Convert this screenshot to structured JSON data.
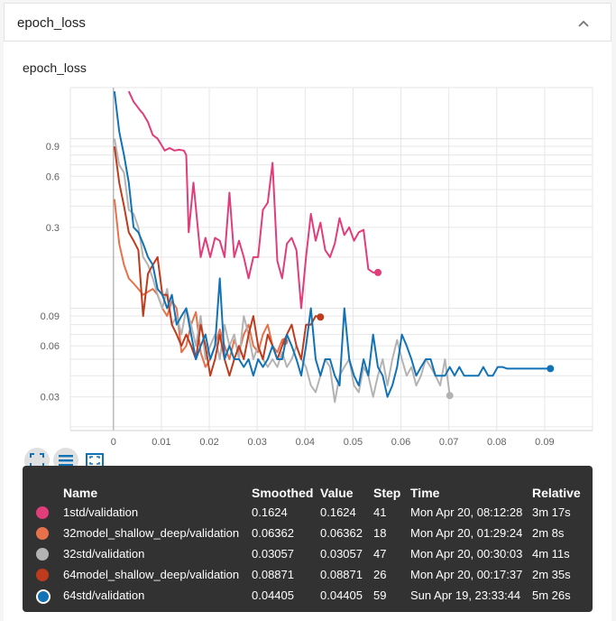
{
  "card": {
    "title": "epoch_loss"
  },
  "chart_data": {
    "type": "line",
    "title": "epoch_loss",
    "x_scale": "linear",
    "y_scale": "log",
    "xlim": [
      -0.009,
      0.1
    ],
    "ylim": [
      0.019,
      2.0
    ],
    "x_ticks": [
      "0",
      "0.01",
      "0.02",
      "0.03",
      "0.04",
      "0.05",
      "0.06",
      "0.07",
      "0.08",
      "0.09"
    ],
    "x_tick_values": [
      0,
      0.01,
      0.02,
      0.03,
      0.04,
      0.05,
      0.06,
      0.07,
      0.08,
      0.09
    ],
    "y_ticks": [
      "0.03",
      "0.06",
      "0.09",
      "0.3",
      "0.6",
      "0.9"
    ],
    "y_tick_values": [
      0.03,
      0.06,
      0.09,
      0.3,
      0.6,
      0.9
    ],
    "grid": true,
    "series": [
      {
        "name": "1std/validation",
        "color": "#e13d7a",
        "x": [
          0.0032,
          0.0042,
          0.0057,
          0.0062,
          0.0072,
          0.0082,
          0.0092,
          0.0097,
          0.0107,
          0.0117,
          0.0127,
          0.0137,
          0.0147,
          0.0152,
          0.0157,
          0.0167,
          0.0177,
          0.0182,
          0.0192,
          0.0202,
          0.0212,
          0.0222,
          0.0232,
          0.0242,
          0.0252,
          0.0262,
          0.0272,
          0.0282,
          0.0292,
          0.0302,
          0.0312,
          0.0322,
          0.0332,
          0.0342,
          0.0352,
          0.0362,
          0.0372,
          0.0382,
          0.0392,
          0.0402,
          0.0412,
          0.0422,
          0.0432,
          0.0442,
          0.0452,
          0.0462,
          0.0472,
          0.0482,
          0.0492,
          0.0502,
          0.0512,
          0.0522,
          0.0532,
          0.0542,
          0.0552
        ],
        "y": [
          1.9,
          1.65,
          1.45,
          1.4,
          1.25,
          1.05,
          1.0,
          0.95,
          0.85,
          0.88,
          0.85,
          0.86,
          0.85,
          0.8,
          0.28,
          0.55,
          0.28,
          0.2,
          0.26,
          0.2,
          0.26,
          0.25,
          0.2,
          0.48,
          0.2,
          0.25,
          0.2,
          0.15,
          0.2,
          0.2,
          0.38,
          0.42,
          0.72,
          0.19,
          0.15,
          0.24,
          0.26,
          0.22,
          0.1,
          0.2,
          0.36,
          0.25,
          0.32,
          0.22,
          0.2,
          0.24,
          0.34,
          0.27,
          0.3,
          0.25,
          0.28,
          0.29,
          0.17,
          0.1624,
          0.1624
        ]
      },
      {
        "name": "32model_shallow_deep/validation",
        "color": "#e7714a",
        "x": [
          0.0002,
          0.0012,
          0.0022,
          0.0032,
          0.0042,
          0.0052,
          0.0062,
          0.0072,
          0.0082,
          0.0092,
          0.0102,
          0.0112,
          0.0122,
          0.0132,
          0.0142,
          0.0152,
          0.0162,
          0.0172,
          0.0182,
          0.0192,
          0.0202,
          0.0212,
          0.0222,
          0.0232,
          0.0242,
          0.0252,
          0.0262,
          0.0272,
          0.0282,
          0.0292,
          0.0302,
          0.0312,
          0.0322,
          0.0332,
          0.0342,
          0.0352,
          0.0357
        ],
        "y": [
          0.44,
          0.24,
          0.18,
          0.15,
          0.14,
          0.13,
          0.12,
          0.125,
          0.13,
          0.12,
          0.1,
          0.09,
          0.11,
          0.1,
          0.055,
          0.06,
          0.08,
          0.095,
          0.055,
          0.045,
          0.05,
          0.06,
          0.075,
          0.06,
          0.05,
          0.065,
          0.055,
          0.07,
          0.08,
          0.06,
          0.055,
          0.07,
          0.08,
          0.06,
          0.055,
          0.065,
          0.06362
        ]
      },
      {
        "name": "32std/validation",
        "color": "#b3b3b3",
        "x": [
          0.0002,
          0.0012,
          0.0022,
          0.0032,
          0.0042,
          0.0052,
          0.0062,
          0.0072,
          0.0082,
          0.0092,
          0.0102,
          0.0112,
          0.0122,
          0.0132,
          0.0142,
          0.0152,
          0.0162,
          0.0172,
          0.0182,
          0.0192,
          0.0202,
          0.0212,
          0.0222,
          0.0232,
          0.0242,
          0.0252,
          0.0262,
          0.0272,
          0.0282,
          0.0292,
          0.0302,
          0.0312,
          0.0322,
          0.0332,
          0.0342,
          0.0352,
          0.0362,
          0.0372,
          0.0382,
          0.0392,
          0.0402,
          0.0412,
          0.0422,
          0.0432,
          0.0442,
          0.0452,
          0.0462,
          0.0472,
          0.0482,
          0.0492,
          0.0502,
          0.0512,
          0.0522,
          0.0532,
          0.0542,
          0.0552,
          0.0562,
          0.0572,
          0.0582,
          0.0592,
          0.0602,
          0.0612,
          0.0622,
          0.0632,
          0.0642,
          0.0652,
          0.0662,
          0.0672,
          0.0682,
          0.0692,
          0.0702
        ],
        "y": [
          1.0,
          0.7,
          0.63,
          0.38,
          0.36,
          0.3,
          0.2,
          0.18,
          0.15,
          0.12,
          0.1,
          0.13,
          0.08,
          0.09,
          0.07,
          0.1,
          0.08,
          0.06,
          0.09,
          0.05,
          0.06,
          0.07,
          0.05,
          0.08,
          0.06,
          0.07,
          0.05,
          0.09,
          0.07,
          0.05,
          0.06,
          0.05,
          0.045,
          0.05,
          0.045,
          0.055,
          0.045,
          0.05,
          0.06,
          0.05,
          0.045,
          0.035,
          0.032,
          0.04,
          0.05,
          0.045,
          0.028,
          0.04,
          0.045,
          0.05,
          0.035,
          0.032,
          0.045,
          0.04,
          0.03,
          0.04,
          0.05,
          0.035,
          0.05,
          0.065,
          0.05,
          0.04,
          0.045,
          0.035,
          0.04,
          0.05,
          0.045,
          0.04,
          0.035,
          0.05,
          0.03057
        ]
      },
      {
        "name": "64model_shallow_deep/validation",
        "color": "#bf3b1e",
        "x": [
          0.0002,
          0.0012,
          0.0022,
          0.0032,
          0.0042,
          0.0052,
          0.0062,
          0.0072,
          0.0082,
          0.0092,
          0.0102,
          0.0112,
          0.0122,
          0.0132,
          0.0142,
          0.0152,
          0.0162,
          0.0172,
          0.0182,
          0.0192,
          0.0202,
          0.0212,
          0.0222,
          0.0232,
          0.0242,
          0.0252,
          0.0262,
          0.0272,
          0.0282,
          0.0292,
          0.0302,
          0.0312,
          0.0322,
          0.0332,
          0.0342,
          0.0352,
          0.0362,
          0.0372,
          0.0382,
          0.0392,
          0.0402,
          0.0412,
          0.0422,
          0.0432
        ],
        "y": [
          0.9,
          0.55,
          0.4,
          0.28,
          0.25,
          0.22,
          0.09,
          0.16,
          0.18,
          0.2,
          0.12,
          0.12,
          0.08,
          0.07,
          0.06,
          0.07,
          0.06,
          0.05,
          0.08,
          0.06,
          0.04,
          0.05,
          0.07,
          0.05,
          0.04,
          0.05,
          0.06,
          0.05,
          0.07,
          0.09,
          0.06,
          0.05,
          0.07,
          0.06,
          0.05,
          0.06,
          0.07,
          0.08,
          0.06,
          0.05,
          0.08,
          0.08,
          0.09,
          0.08871
        ]
      },
      {
        "name": "64std/validation",
        "color": "#1172b5",
        "x": [
          0.0002,
          0.0012,
          0.0022,
          0.0032,
          0.0042,
          0.0052,
          0.0062,
          0.0072,
          0.0082,
          0.0092,
          0.0102,
          0.0112,
          0.0122,
          0.0132,
          0.0142,
          0.0152,
          0.0162,
          0.0172,
          0.0182,
          0.0192,
          0.0202,
          0.0212,
          0.0222,
          0.0232,
          0.0242,
          0.0252,
          0.0262,
          0.0272,
          0.0282,
          0.0292,
          0.0302,
          0.0312,
          0.0322,
          0.0332,
          0.0342,
          0.0352,
          0.0362,
          0.0372,
          0.0382,
          0.0392,
          0.0402,
          0.0412,
          0.0422,
          0.0432,
          0.0442,
          0.0452,
          0.0462,
          0.0472,
          0.0482,
          0.0492,
          0.0502,
          0.0512,
          0.0522,
          0.0532,
          0.0542,
          0.0552,
          0.0562,
          0.0572,
          0.0582,
          0.0592,
          0.0602,
          0.0612,
          0.0622,
          0.0632,
          0.0642,
          0.0652,
          0.0662,
          0.0672,
          0.0682,
          0.0692,
          0.0702,
          0.0712,
          0.0722,
          0.0732,
          0.0742,
          0.0752,
          0.0762,
          0.0772,
          0.0782,
          0.0792,
          0.0802,
          0.0812,
          0.0822,
          0.0832,
          0.0842,
          0.0852,
          0.0862,
          0.0872,
          0.0882,
          0.0892,
          0.0902,
          0.0912
        ],
        "y": [
          1.9,
          1.1,
          0.8,
          0.55,
          0.3,
          0.28,
          0.24,
          0.2,
          0.18,
          0.13,
          0.12,
          0.1,
          0.12,
          0.08,
          0.09,
          0.1,
          0.07,
          0.05,
          0.06,
          0.07,
          0.05,
          0.06,
          0.15,
          0.05,
          0.06,
          0.05,
          0.05,
          0.045,
          0.05,
          0.04,
          0.05,
          0.045,
          0.05,
          0.06,
          0.05,
          0.05,
          0.07,
          0.06,
          0.05,
          0.04,
          0.06,
          0.1,
          0.05,
          0.04,
          0.05,
          0.05,
          0.04,
          0.035,
          0.1,
          0.05,
          0.04,
          0.035,
          0.05,
          0.04,
          0.07,
          0.045,
          0.04,
          0.03,
          0.035,
          0.045,
          0.07,
          0.06,
          0.05,
          0.04,
          0.045,
          0.05,
          0.05,
          0.04,
          0.04,
          0.04,
          0.045,
          0.04,
          0.045,
          0.04,
          0.04,
          0.04,
          0.04,
          0.045,
          0.04,
          0.04,
          0.045,
          0.045,
          0.04405,
          0.04405,
          0.04405,
          0.04405,
          0.04405,
          0.04405,
          0.04405,
          0.04405,
          0.04405,
          0.04405
        ]
      }
    ]
  },
  "controls": {
    "fit_icon": "fit-domain-icon",
    "log_icon": "log-scale-icon",
    "expand_icon": "expand-icon"
  },
  "tooltip": {
    "headers": [
      "Name",
      "Smoothed",
      "Value",
      "Step",
      "Time",
      "Relative"
    ],
    "rows": [
      {
        "color": "#e13d7a",
        "name": "1std/validation",
        "smoothed": "0.1624",
        "value": "0.1624",
        "step": "41",
        "time": "Mon Apr 20, 08:12:28",
        "relative": "3m 17s",
        "selected": false
      },
      {
        "color": "#e7714a",
        "name": "32model_shallow_deep/validation",
        "smoothed": "0.06362",
        "value": "0.06362",
        "step": "18",
        "time": "Mon Apr 20, 01:29:24",
        "relative": "2m 8s",
        "selected": false
      },
      {
        "color": "#b3b3b3",
        "name": "32std/validation",
        "smoothed": "0.03057",
        "value": "0.03057",
        "step": "47",
        "time": "Mon Apr 20, 00:30:03",
        "relative": "4m 11s",
        "selected": false
      },
      {
        "color": "#bf3b1e",
        "name": "64model_shallow_deep/validation",
        "smoothed": "0.08871",
        "value": "0.08871",
        "step": "26",
        "time": "Mon Apr 20, 00:17:37",
        "relative": "2m 35s",
        "selected": false
      },
      {
        "color": "#1172b5",
        "name": "64std/validation",
        "smoothed": "0.04405",
        "value": "0.04405",
        "step": "59",
        "time": "Sun Apr 19, 23:33:44",
        "relative": "5m 26s",
        "selected": true
      }
    ]
  }
}
